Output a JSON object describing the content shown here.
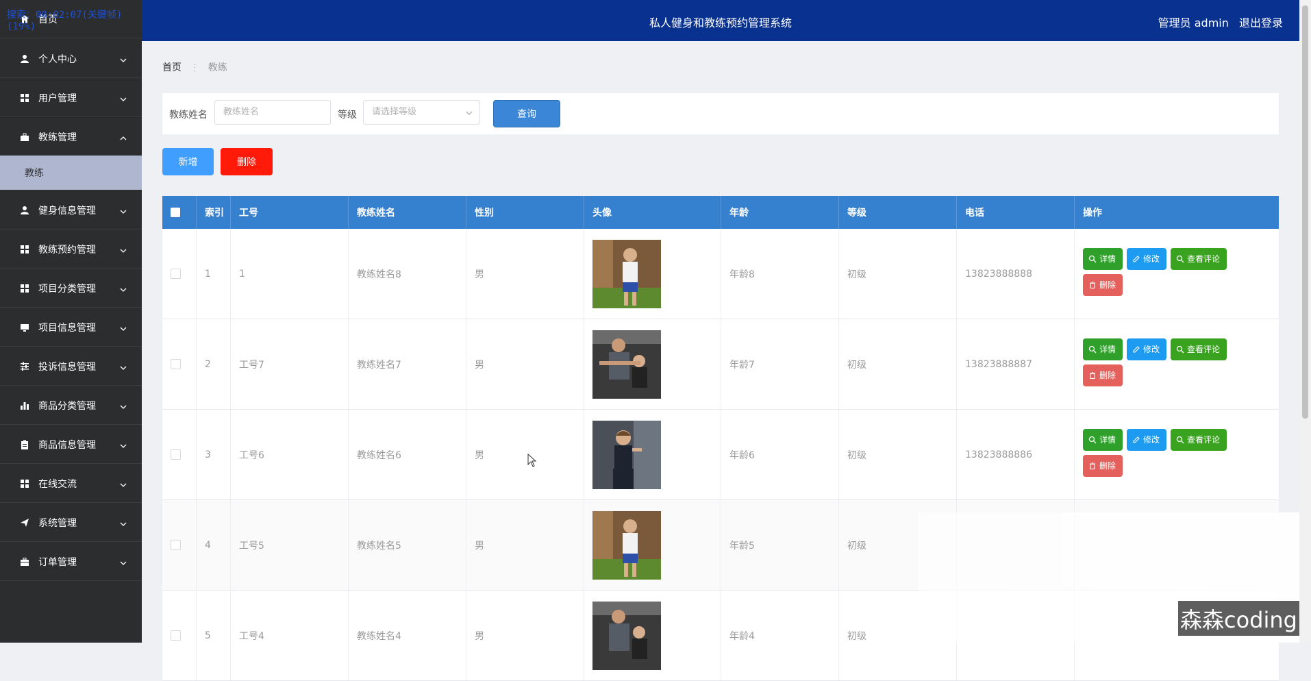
{
  "overlay": {
    "text": "搜索：00:02:07(关键帧)(19%)"
  },
  "header": {
    "title": "私人健身和教练预约管理系统",
    "user": "管理员 admin",
    "logout": "退出登录"
  },
  "sidebar": {
    "items": [
      {
        "label": "首页",
        "icon": "home-icon"
      },
      {
        "label": "个人中心",
        "icon": "person-icon"
      },
      {
        "label": "用户管理",
        "icon": "grid-icon"
      },
      {
        "label": "教练管理",
        "icon": "briefcase-icon",
        "expanded": true
      },
      {
        "label": "健身信息管理",
        "icon": "person-icon"
      },
      {
        "label": "教练预约管理",
        "icon": "grid-icon"
      },
      {
        "label": "项目分类管理",
        "icon": "grid-icon"
      },
      {
        "label": "项目信息管理",
        "icon": "monitor-icon"
      },
      {
        "label": "投诉信息管理",
        "icon": "sliders-icon"
      },
      {
        "label": "商品分类管理",
        "icon": "bar-chart-icon"
      },
      {
        "label": "商品信息管理",
        "icon": "clipboard-icon"
      },
      {
        "label": "在线交流",
        "icon": "grid-icon"
      },
      {
        "label": "系统管理",
        "icon": "send-icon"
      },
      {
        "label": "订单管理",
        "icon": "toolbox-icon"
      }
    ],
    "subitem": "教练"
  },
  "breadcrumb": {
    "home": "首页",
    "sep": "⋮",
    "current": "教练"
  },
  "search": {
    "name_label": "教练姓名",
    "name_placeholder": "教练姓名",
    "level_label": "等级",
    "level_placeholder": "请选择等级",
    "query_button": "查询"
  },
  "actions": {
    "add": "新增",
    "delete": "删除"
  },
  "table": {
    "headers": [
      "索引",
      "工号",
      "教练姓名",
      "性别",
      "头像",
      "年龄",
      "等级",
      "电话",
      "操作"
    ],
    "rows": [
      {
        "index": "1",
        "id": "1",
        "name": "教练姓名8",
        "gender": "男",
        "age": "年龄8",
        "level": "初级",
        "phone": "13823888888"
      },
      {
        "index": "2",
        "id": "工号7",
        "name": "教练姓名7",
        "gender": "男",
        "age": "年龄7",
        "level": "初级",
        "phone": "13823888887"
      },
      {
        "index": "3",
        "id": "工号6",
        "name": "教练姓名6",
        "gender": "男",
        "age": "年龄6",
        "level": "初级",
        "phone": "13823888886"
      },
      {
        "index": "4",
        "id": "工号5",
        "name": "教练姓名5",
        "gender": "男",
        "age": "年龄5",
        "level": "初级",
        "phone": ""
      },
      {
        "index": "5",
        "id": "工号4",
        "name": "教练姓名4",
        "gender": "男",
        "age": "年龄4",
        "level": "初级",
        "phone": ""
      }
    ],
    "ops": {
      "detail": "详情",
      "edit": "修改",
      "review": "查看评论",
      "delete": "删除"
    }
  },
  "watermark": "森森coding",
  "colors": {
    "header": "#09318f",
    "sidebar": "#2b2d2f",
    "table_header": "#3580cf",
    "add": "#409eff",
    "delete": "#ff1a0a"
  }
}
